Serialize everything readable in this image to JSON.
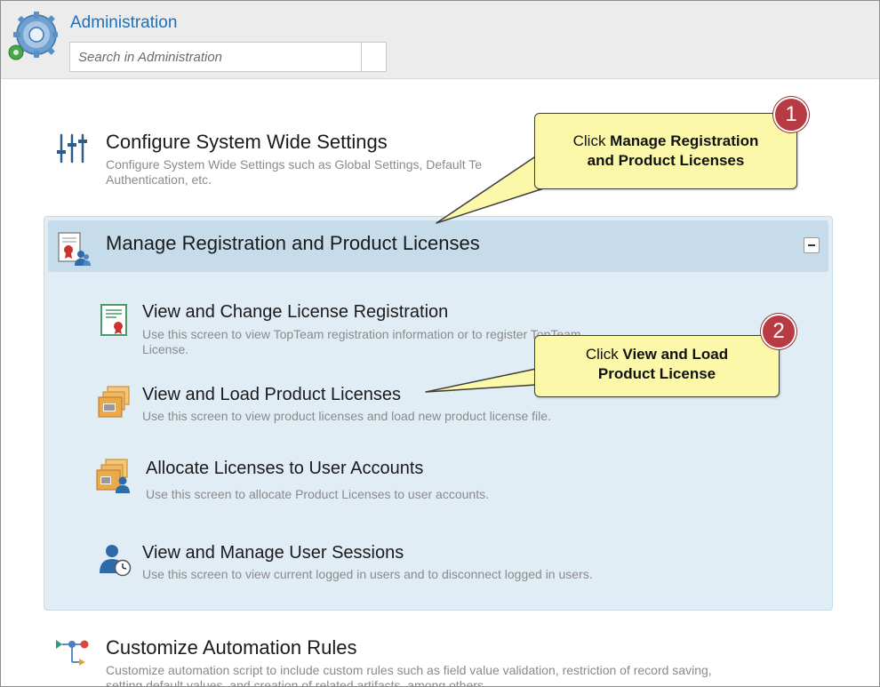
{
  "header": {
    "title": "Administration",
    "search_placeholder": "Search in Administration"
  },
  "sections": {
    "configure": {
      "title": "Configure System Wide Settings",
      "desc_line1": "Configure System Wide Settings such as Global Settings, Default Te",
      "desc_line2": "Authentication, etc."
    },
    "manage_registration": {
      "title": "Manage Registration and Product Licenses",
      "items": [
        {
          "title": "View and Change License Registration",
          "desc_line1": "Use this screen to view TopTeam registration information or to register TopTeam",
          "desc_line2": "License."
        },
        {
          "title": "View and Load Product Licenses",
          "desc_line1": "Use this screen to view product licenses and load new product license file."
        },
        {
          "title": "Allocate Licenses to User Accounts",
          "desc_line1": "Use this screen to allocate Product Licenses to user accounts."
        },
        {
          "title": "View and Manage User Sessions",
          "desc_line1": "Use this screen to view current logged in users and to disconnect logged in users."
        }
      ]
    },
    "automation": {
      "title": "Customize Automation Rules",
      "desc_line1": "Customize automation script to include custom rules such as field value validation, restriction of record saving,",
      "desc_line2": "setting default values, and creation of related artifacts, among others."
    }
  },
  "callouts": [
    {
      "number": "1",
      "prefix": "Click ",
      "bold_line1": "Manage Registration",
      "bold_line2": "and Product Licenses"
    },
    {
      "number": "2",
      "prefix": "Click ",
      "bold_line1": "View and Load",
      "bold_line2": "Product License"
    }
  ],
  "colors": {
    "title_blue": "#1f6fb8",
    "panel_bg": "#e1edf5",
    "panel_header": "#c7dceb",
    "callout_bg": "#fbf8a9",
    "badge_red": "#b83a43"
  }
}
